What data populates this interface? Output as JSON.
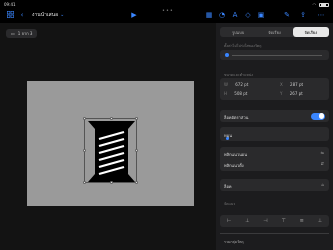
{
  "status_bar": {
    "time": "09:41",
    "signal": "wifi-icon",
    "battery": "battery-icon"
  },
  "toolbar": {
    "doc_title": "งานนำเสนอ",
    "grid_icon": "grid-icon",
    "back_icon": "back-icon",
    "chevron_icon": "chevron-down-icon",
    "play_icon": "play-icon",
    "table_icon": "table-icon",
    "chart_icon": "chart-icon",
    "text_icon": "text-icon",
    "shape_icon": "shape-icon",
    "media_icon": "media-icon",
    "brush_icon": "brush-icon",
    "share_icon": "share-icon",
    "more_icon": "more-icon",
    "more_dots": "•••"
  },
  "page_tab": {
    "label": "1 จาก 3"
  },
  "panel": {
    "tabs": [
      "รูปแบบ",
      "จัดเรียง",
      "จัดเรียง"
    ],
    "active_tab": 2,
    "section_slide": "ตั้งค่าไม่โปร่งใสของวัตถุ",
    "section_size": "ขนาดและตำแหน่ง",
    "w_label": "W",
    "w_value": "672 pt",
    "x_label": "X",
    "x_value": "287 pt",
    "h_label": "H",
    "h_value": "508 pt",
    "y_label": "Y",
    "y_value": "267 pt",
    "constrain_label": "ล็อคอัตราส่วน",
    "rotate_label": "หมุน",
    "flip_h_label": "พลิกแนวนอน",
    "flip_v_label": "พลิกแนวตั้ง",
    "lock_label": "ล็อค",
    "align_label": "จัดแนว",
    "group_label": "รวมกลุ่มวัตถุ"
  },
  "colors": {
    "accent": "#3a86ff",
    "panel_bg": "#1c1c1e",
    "slide_bg": "#9a9a9a"
  }
}
